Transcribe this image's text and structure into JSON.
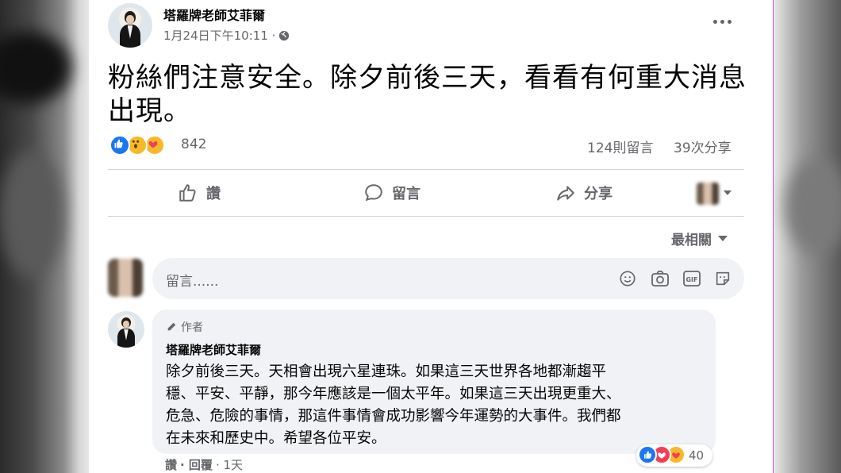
{
  "post": {
    "author": "塔羅牌老師艾菲爾",
    "timestamp": "1月24日下午10:11 ·",
    "text_line1": "粉絲們注意安全。除夕前後三天，看看有何重大消息",
    "text_line2": "出現。",
    "reaction_count": "842",
    "comments_count": "124則留言",
    "shares_count": "39次分享"
  },
  "actions": {
    "like": "讚",
    "comment": "留言",
    "share": "分享"
  },
  "sort": {
    "label": "最相關"
  },
  "composer": {
    "placeholder": "留言......"
  },
  "comment": {
    "author_badge": "作者",
    "author": "塔羅牌老師艾菲爾",
    "lines": [
      "除夕前後三天。天相會出現六星連珠。如果這三天世界各地都漸趨平",
      "穩、平安、平靜，那今年應該是一個太平年。如果這三天出現更重大、",
      "危急、危險的事情，那這件事情會成功影響今年運勢的大事件。我們都",
      "在未來和歷史中。希望各位平安。"
    ],
    "like_label": "讚",
    "reply_label": "· 回覆",
    "age": "· 1天",
    "reaction_count": "40"
  },
  "colors": {
    "accent": "#1877f2",
    "secondary_text": "#65676b",
    "comment_bg": "#f0f2f5"
  }
}
